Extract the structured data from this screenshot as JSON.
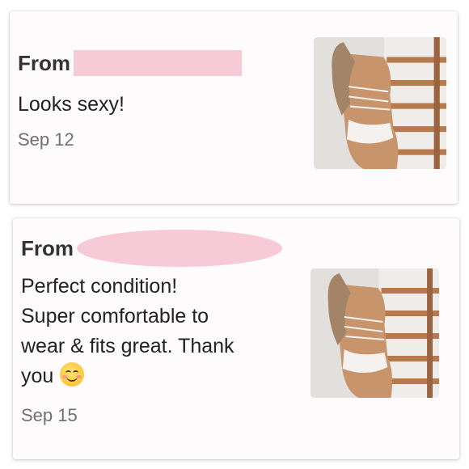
{
  "messages": [
    {
      "from_label": "From",
      "lines": [
        "Looks sexy!"
      ],
      "date": "Sep 12",
      "photo": "lingerie-bodysuit-photo"
    },
    {
      "from_label": "From",
      "lines": [
        "Perfect condition!",
        "Super comfortable to",
        "wear & fits great. Thank",
        "you"
      ],
      "emoji": "smiling-face-emoji",
      "date": "Sep 15",
      "photo": "lingerie-bodysuit-photo"
    }
  ],
  "colors": {
    "redaction": "#f7cad8",
    "card_background": "#fdfbfb",
    "text": "#222222",
    "date_text": "#707070"
  }
}
